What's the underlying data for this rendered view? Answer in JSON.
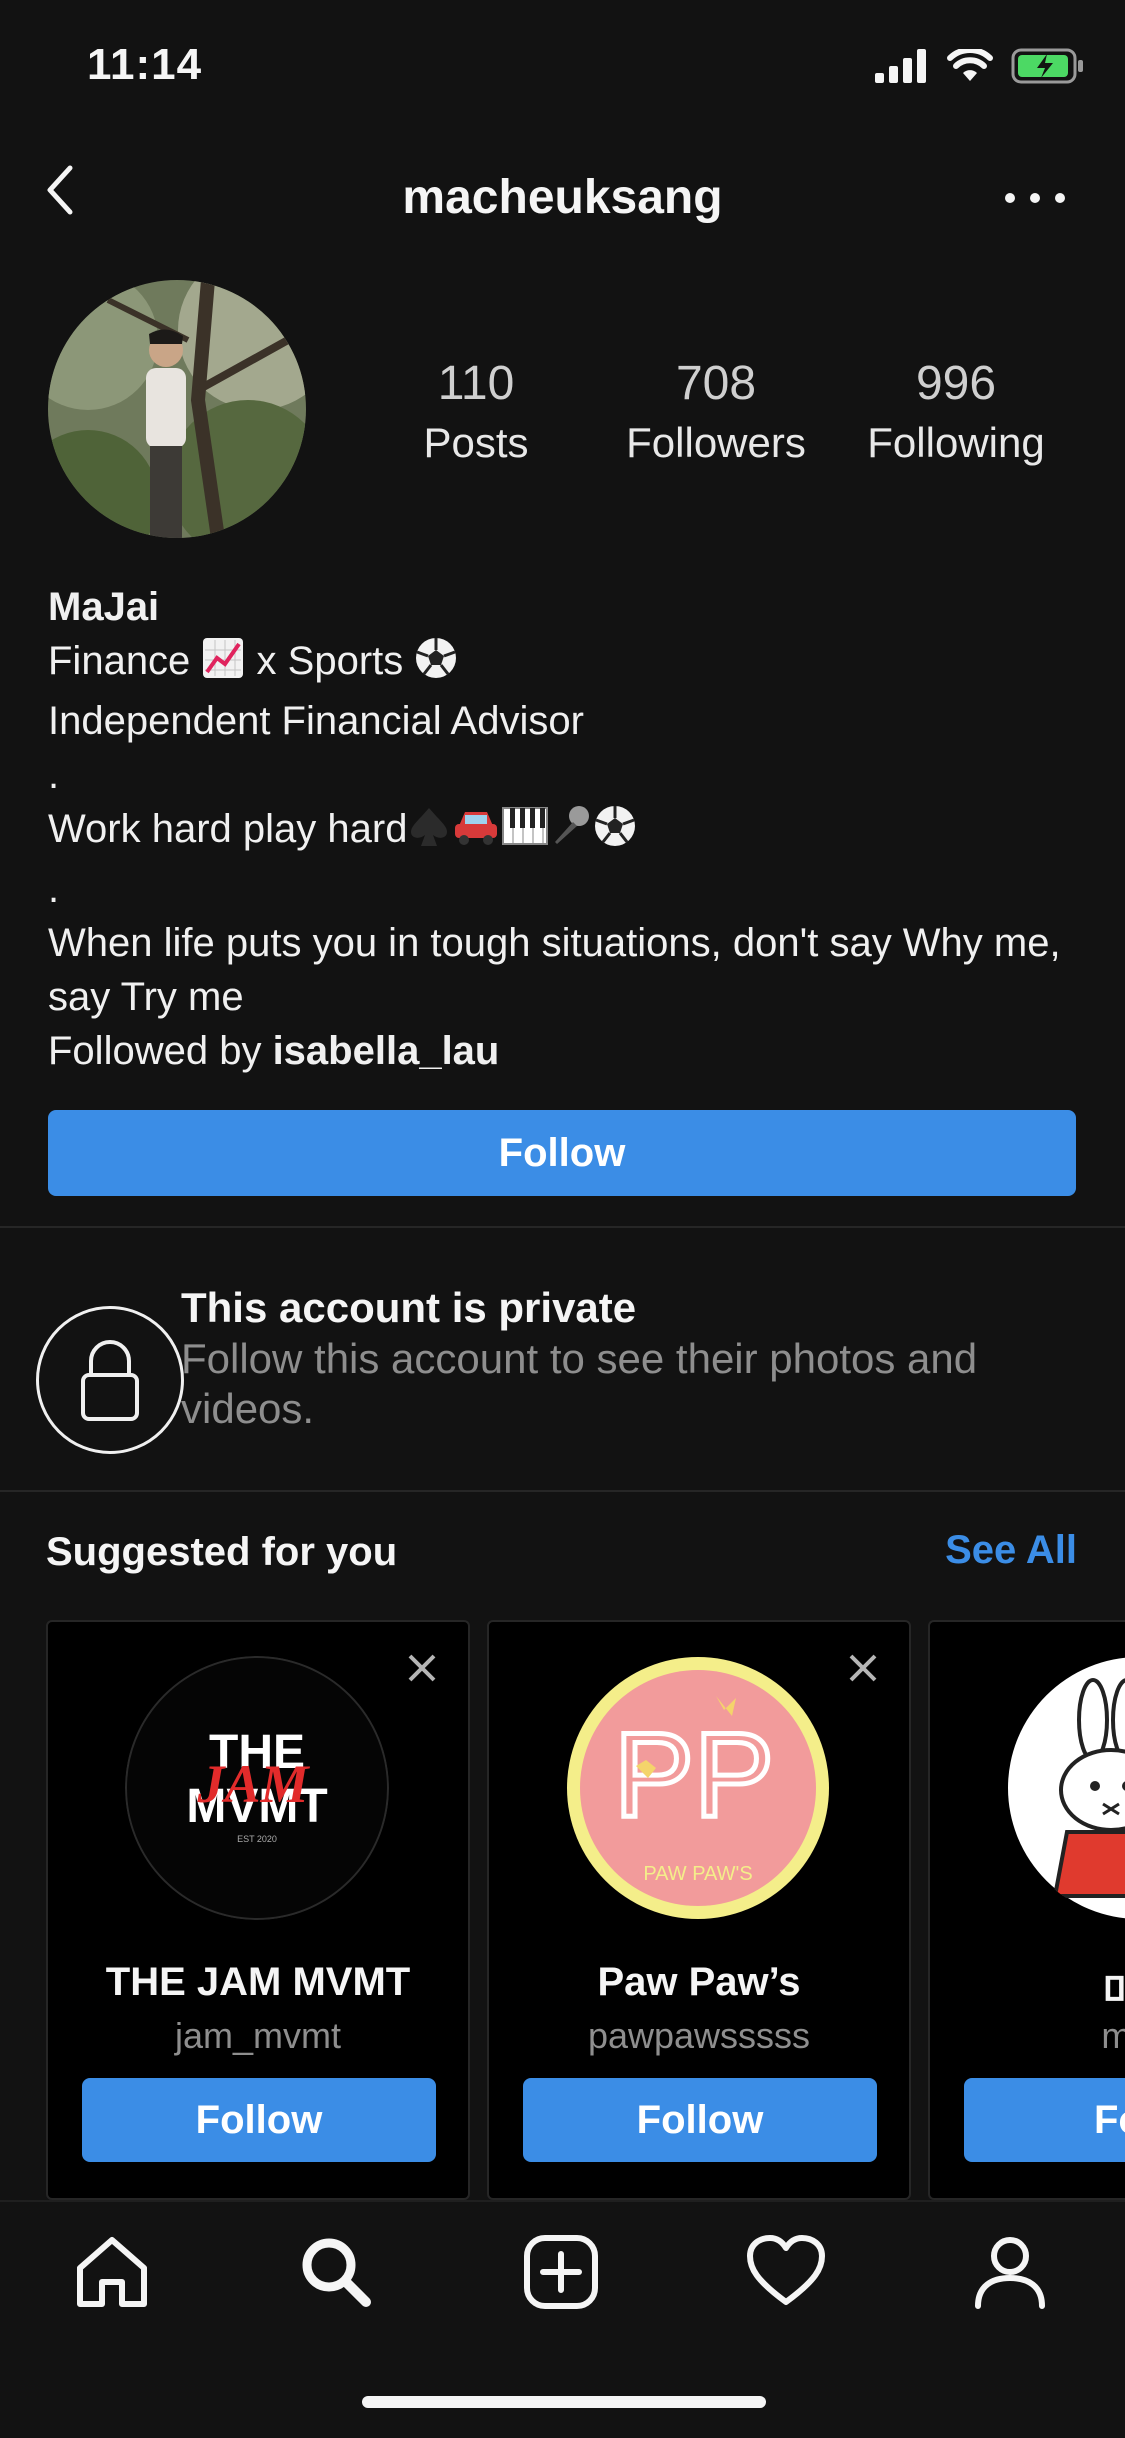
{
  "status": {
    "time": "11:14"
  },
  "header": {
    "title": "macheuksang"
  },
  "stats": [
    {
      "value": "110",
      "label": "Posts"
    },
    {
      "value": "708",
      "label": "Followers"
    },
    {
      "value": "996",
      "label": "Following"
    }
  ],
  "bio": {
    "name": "MaJai",
    "line1_a": "Finance ",
    "line1_b": " x Sports ",
    "line2": "Independent Financial Advisor",
    "dot": ".",
    "line3": "Work hard play hard",
    "line4": "When life puts you in tough situations, don't say Why me, say Try me",
    "followed_prefix": "Followed by ",
    "followed_user": "isabella_lau"
  },
  "follow_label": "Follow",
  "private": {
    "title": "This account is private",
    "subtitle": "Follow this account to see their photos and videos."
  },
  "suggested": {
    "title": "Suggested for you",
    "see_all": "See All",
    "cards": [
      {
        "name": "THE JAM MVMT",
        "username": "jam_mvmt",
        "button": "Follow",
        "logo_text_top": "THE",
        "logo_text_mid": "JAM",
        "logo_text_bot": "MVMT",
        "logo_small": "EST 2020"
      },
      {
        "name": "Paw Paw’s",
        "username": "pawpawsssss",
        "button": "Follow",
        "logo_text": "PP",
        "logo_small": "PAW PAW'S"
      },
      {
        "name": "미피",
        "username": "miffy",
        "button": "Fo"
      }
    ]
  },
  "colors": {
    "accent": "#3b8de6",
    "background": "#121212",
    "muted": "#8e8e8e"
  },
  "icons": [
    "back-chevron-icon",
    "more-options-icon",
    "lock-icon",
    "close-icon",
    "home-icon",
    "search-icon",
    "add-post-icon",
    "heart-icon",
    "profile-icon"
  ]
}
